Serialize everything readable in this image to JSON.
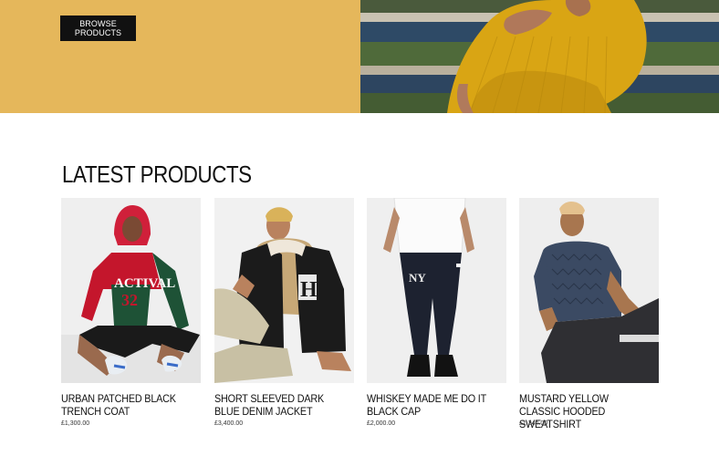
{
  "hero": {
    "browse_label": "BROWSE PRODUCTS"
  },
  "section": {
    "title": "LATEST PRODUCTS"
  },
  "products": [
    {
      "name": "URBAN PATCHED BLACK TRENCH COAT",
      "price": "£1,300.00"
    },
    {
      "name": "SHORT SLEEVED DARK BLUE DENIM JACKET",
      "price": "£3,400.00"
    },
    {
      "name": "WHISKEY MADE ME DO IT BLACK CAP",
      "price": "£2,000.00"
    },
    {
      "name": "MUSTARD YELLOW CLASSIC HOODED SWEATSHIRT",
      "price": "£1,344.00"
    }
  ],
  "colors": {
    "hero_yellow": "#e5b75b",
    "button_black": "#111111"
  }
}
